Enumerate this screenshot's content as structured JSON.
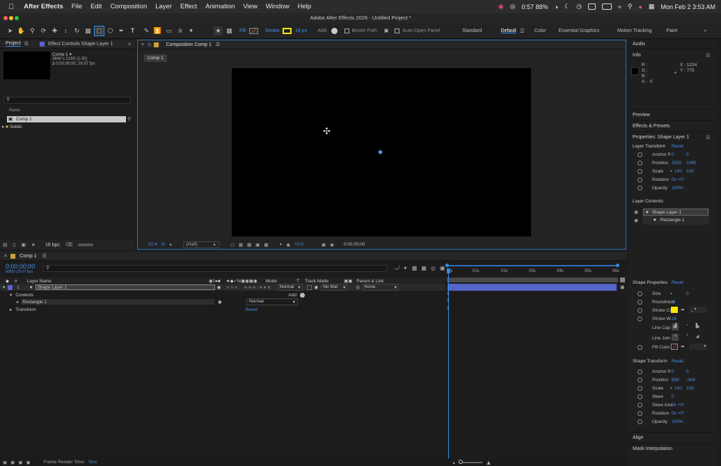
{
  "menubar": {
    "app_name": "After Effects",
    "items": [
      "File",
      "Edit",
      "Composition",
      "Layer",
      "Effect",
      "Animation",
      "View",
      "Window",
      "Help"
    ],
    "battery": "0:57 88%",
    "datetime": "Mon Feb 2  3:53 AM"
  },
  "window_title": "Adobe After Effects 2026 - Untitled Project *",
  "toolbar": {
    "fill_label": "Fill:",
    "stroke_label": "Stroke:",
    "stroke_width": "16 px",
    "add_label": "Add:",
    "bezier_label": "Bezier Path",
    "auto_open_label": "Auto-Open Panel",
    "workspaces": [
      "Standard",
      "Default",
      "Color",
      "Essential Graphics",
      "Motion Tracking",
      "Paint"
    ],
    "active_workspace": "Default"
  },
  "project": {
    "tab_project": "Project",
    "tab_effect": "Effect Controls Shape Layer 1",
    "comp_name": "Comp 1 ▾",
    "comp_size": "3840 x 2160 (1.00)",
    "comp_duration": "Δ 0;00;06;00, 29.97 fps",
    "col_name": "Name",
    "items": [
      "Comp 1",
      "Solids"
    ],
    "bpc": "16 bpc"
  },
  "composition": {
    "tab_label": "Composition Comp 1",
    "comp_tab": "Comp 1",
    "zoom": "37.4",
    "zoom_unit": "%",
    "resolution": "(Half)",
    "exposure": "+0.0",
    "timecode": "0;00;00;00"
  },
  "right_panel": {
    "audio": "Audio",
    "info": "Info",
    "info_r": "R :",
    "info_g": "G :",
    "info_b": "B :",
    "info_a": "A :",
    "info_a_val": "0",
    "info_x": "X : 1224",
    "info_y": "Y : 775",
    "preview": "Preview",
    "effects_presets": "Effects & Presets",
    "properties_title": "Properties: Shape Layer 1",
    "layer_transform": "Layer Transform",
    "reset": "Reset",
    "lt_anchor_label": "Anchor P.",
    "lt_anchor_x": "0",
    "lt_anchor_y": "0",
    "lt_position_label": "Position",
    "lt_position_x": "1920",
    "lt_position_y": "1080",
    "lt_scale_label": "Scale",
    "lt_scale_x": "100",
    "lt_scale_y": "100",
    "lt_rotation_label": "Rotation",
    "lt_rotation_val": "0x +0°",
    "lt_opacity_label": "Opacity",
    "lt_opacity_val": "100%",
    "layer_contents": "Layer Contents",
    "content_items": [
      "Shape Layer 1",
      "Rectangle 1"
    ],
    "shape_properties": "Shape Properties",
    "sp_size_label": "Size",
    "sp_size_val": "0",
    "sp_roundness_label": "Roundness",
    "sp_roundness_val": "0",
    "sp_stroke_color_label": "Stroke Co",
    "sp_stroke_width_label": "Stroke W.",
    "sp_stroke_width_val": "16",
    "sp_line_cap_label": "Line Cap",
    "sp_line_join_label": "Line Join",
    "sp_fill_color_label": "Fill Color",
    "shape_transform": "Shape Transform",
    "st_anchor_label": "Anchor P.",
    "st_anchor_x": "0",
    "st_anchor_y": "0",
    "st_position_label": "Position",
    "st_position_x": "695",
    "st_position_y": "-304",
    "st_scale_label": "Scale",
    "st_scale_x": "100",
    "st_scale_y": "100",
    "st_skew_label": "Skew",
    "st_skew_val": "0",
    "st_skew_axis_label": "Skew Axis",
    "st_skew_axis_val": "0x +0°",
    "st_rotation_label": "Rotation",
    "st_rotation_val": "0x +0°",
    "st_opacity_label": "Opacity",
    "st_opacity_val": "100%",
    "align": "Align",
    "mask_interpolation": "Mask Interpolation"
  },
  "timeline": {
    "tab": "Comp 1",
    "timecode": "0;00;00;00",
    "frames": "00000 (29.97 fps)",
    "col_layer_name": "Layer Name",
    "col_mode": "Mode",
    "col_t": "T",
    "col_track_matte": "Track Matte",
    "col_parent": "Parent & Link",
    "layer_index": "1",
    "layer_name": "Shape Layer 1",
    "layer_mode": "Normal",
    "layer_matte": "No Mat",
    "layer_parent": "None",
    "contents": "Contents",
    "add_label": "Add:",
    "rectangle": "Rectangle 1",
    "rect_mode": "Normal",
    "transform": "Transform",
    "reset": "Reset",
    "ruler": [
      "0s",
      "01s",
      "02s",
      "03s",
      "04s",
      "05s",
      "06s"
    ],
    "render_time_label": "Frame Render Time:",
    "render_time_val": "0ms"
  },
  "colors": {
    "accent_blue": "#2d8ceb",
    "layer_bar": "#5566c8",
    "stroke_yellow": "#f5e600",
    "label_blue": "#4a8fe8"
  }
}
